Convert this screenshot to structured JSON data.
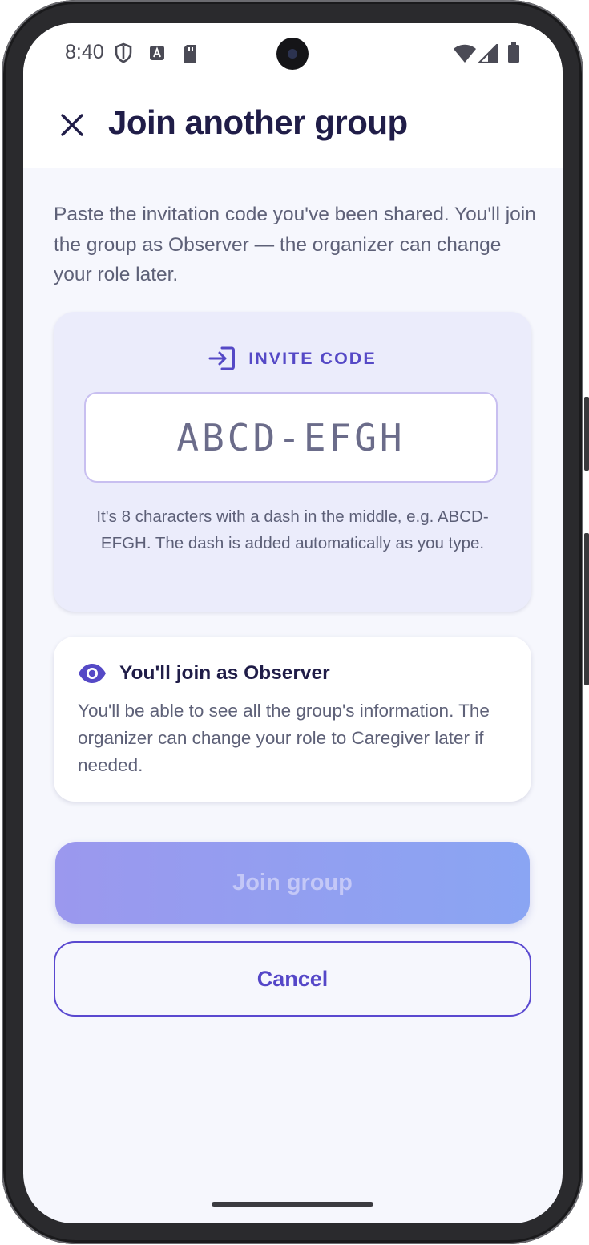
{
  "status_bar": {
    "time": "8:40",
    "icons": [
      "shield-icon",
      "a-badge-icon",
      "sd-card-icon",
      "wifi-icon",
      "signal-icon",
      "battery-icon"
    ]
  },
  "app_bar": {
    "close_icon": "close-icon",
    "title": "Join another group"
  },
  "intro_text": "Paste the invitation code you've been shared. You'll join the group as Observer — the organizer can change your role later.",
  "code_card": {
    "icon": "login-arrow-icon",
    "label": "INVITE CODE",
    "input_value": "",
    "input_placeholder": "ABCD-EFGH",
    "help_text": "It's 8 characters with a dash in the middle, e.g. ABCD-EFGH. The dash is added automatically as you type."
  },
  "role_card": {
    "icon": "eye-icon",
    "title": "You'll join as Observer",
    "body": "You'll be able to see all the group's information. The organizer can change your role to Caregiver later if needed."
  },
  "actions": {
    "join_label": "Join group",
    "cancel_label": "Cancel"
  },
  "colors": {
    "accent": "#5547c8",
    "title": "#201d48",
    "body_text": "#5e6178",
    "card_tint": "#ebecfb",
    "screen_bg": "#f6f7fd"
  }
}
